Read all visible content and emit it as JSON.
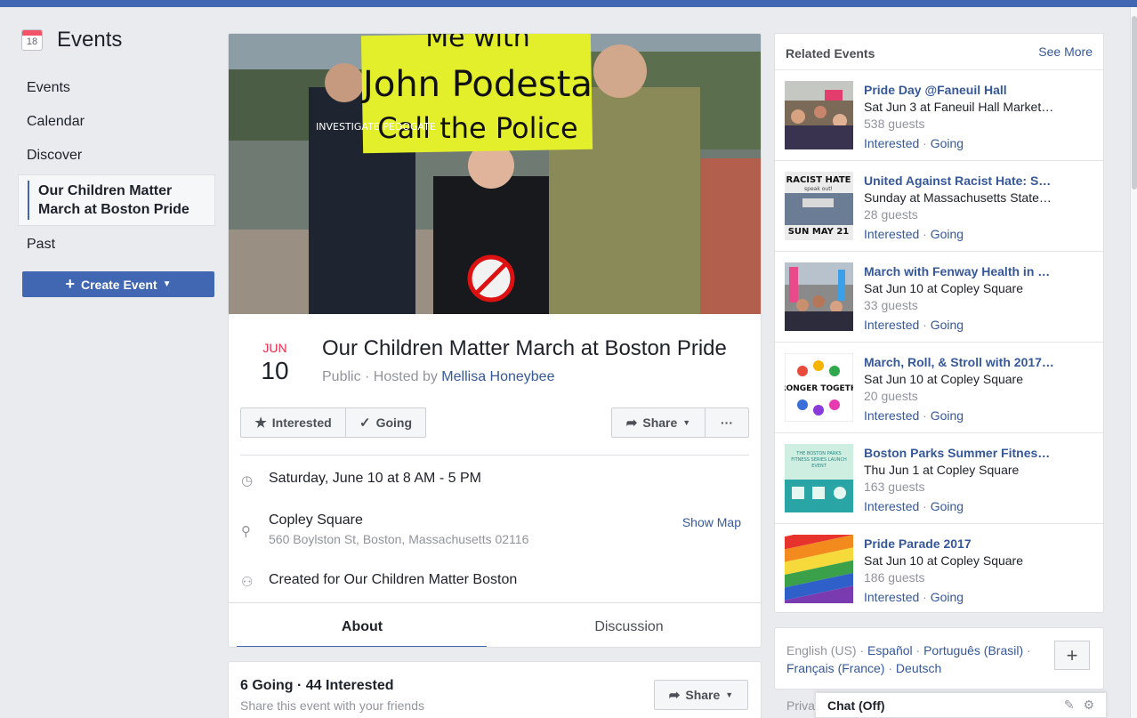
{
  "sidebar": {
    "calendar_day": "18",
    "title": "Events",
    "items": [
      {
        "label": "Events"
      },
      {
        "label": "Calendar"
      },
      {
        "label": "Discover"
      },
      {
        "label": "Our Children Matter March at Boston Pride"
      },
      {
        "label": "Past"
      }
    ],
    "create_label": "Create Event"
  },
  "cover": {
    "sign_line1": "Me with",
    "sign_line2": "John Podesta",
    "sign_line3": "Call the Police",
    "shirt_text": "INVESTIGATE PEDOGATE"
  },
  "event": {
    "month": "JUN",
    "day": "10",
    "title": "Our Children Matter March at Boston Pride",
    "privacy": "Public · Hosted by",
    "host": "Mellisa Honeybee",
    "buttons": {
      "interested": "Interested",
      "going": "Going",
      "share": "Share",
      "more": "···"
    },
    "when": "Saturday, June 10 at 8 AM - 5 PM",
    "location_name": "Copley Square",
    "location_address": "560 Boylston St, Boston, Massachusetts 02116",
    "show_map": "Show Map",
    "created_for": "Created for Our Children Matter Boston",
    "tabs": [
      {
        "label": "About"
      },
      {
        "label": "Discussion"
      }
    ]
  },
  "going_card": {
    "headline": "6 Going · 44 Interested",
    "subtext": "Share this event with your friends",
    "share": "Share"
  },
  "related": {
    "title": "Related Events",
    "see_more": "See More",
    "interested": "Interested",
    "going": "Going",
    "items": [
      {
        "name": "Pride Day @Faneuil Hall",
        "when": "Sat Jun 3 at Faneuil Hall Market…",
        "guests": "538 guests"
      },
      {
        "name": "United Against Racist Hate: S…",
        "when": "Sunday at Massachusetts State…",
        "guests": "28 guests",
        "thumb_top": "RACIST HATE",
        "thumb_mid": "speak out!",
        "thumb_bottom": "SUN MAY 21"
      },
      {
        "name": "March with Fenway Health in …",
        "when": "Sat Jun 10 at Copley Square",
        "guests": "33 guests"
      },
      {
        "name": "March, Roll, & Stroll with 2017…",
        "when": "Sat Jun 10 at Copley Square",
        "guests": "20 guests",
        "thumb_text": "RONGER TOGETH"
      },
      {
        "name": "Boston Parks Summer Fitnes…",
        "when": "Thu Jun 1 at Copley Square",
        "guests": "163 guests",
        "thumb_text": "THE BOSTON PARKS FITNESS SERIES LAUNCH EVENT"
      },
      {
        "name": "Pride Parade 2017",
        "when": "Sat Jun 10 at Copley Square",
        "guests": "186 guests"
      }
    ]
  },
  "languages": {
    "current": "English (US)",
    "links": [
      "Español",
      "Português (Brasil)",
      "Français (France)",
      "Deutsch"
    ]
  },
  "footer": {
    "privacy": "Priva"
  },
  "chat": {
    "label": "Chat (Off)"
  }
}
